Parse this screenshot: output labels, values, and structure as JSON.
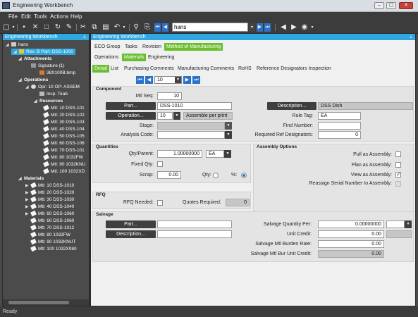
{
  "window": {
    "title": "Engineering Workbench",
    "minimize": "–",
    "maximize": "▢",
    "close": "✕"
  },
  "menu": [
    "File",
    "Edit",
    "Tools",
    "Actions",
    "Help"
  ],
  "toolbar": {
    "search_value": "hans"
  },
  "left_pane": {
    "title": "Engineering Workbench",
    "tree": [
      {
        "label": "hans",
        "level": 0
      },
      {
        "label": "Rev: B Part: DSS-1000",
        "level": 1,
        "selected": true
      },
      {
        "label": "Attachments",
        "level": 2,
        "bold": true
      },
      {
        "label": "Signature (1)",
        "level": 3
      },
      {
        "label": "38X100B.bmp",
        "level": 4
      },
      {
        "label": "Operations",
        "level": 2,
        "bold": true
      },
      {
        "label": "Opr: 10 OP: ASSEM",
        "level": 3
      },
      {
        "label": "Insp: Teab",
        "level": 4
      },
      {
        "label": "Resources",
        "level": 4,
        "bold": true
      },
      {
        "label": "Mtl: 10 DSS-101",
        "level": 5
      },
      {
        "label": "Mtl: 20 DSS-102",
        "level": 5
      },
      {
        "label": "Mtl: 30 DSS-103",
        "level": 5
      },
      {
        "label": "Mtl: 40 DSS-104",
        "level": 5
      },
      {
        "label": "Mtl: 50 DSS-105",
        "level": 5
      },
      {
        "label": "Mtl: 60 DSS-106",
        "level": 5
      },
      {
        "label": "Mtl: 70 DSS-101",
        "level": 5
      },
      {
        "label": "Mtl: 80 1032FW",
        "level": 5
      },
      {
        "label": "Mtl: 90 1032KNU",
        "level": 5
      },
      {
        "label": "Mtl: 100 1032XD",
        "level": 5
      },
      {
        "label": "Materials",
        "level": 2,
        "bold": true
      },
      {
        "label": "Mtl: 10 DSS-1010",
        "level": 3
      },
      {
        "label": "Mtl: 20 DSS-1020",
        "level": 3
      },
      {
        "label": "Mtl: 30 DSS-1030",
        "level": 3
      },
      {
        "label": "Mtl: 40 DSS-1040",
        "level": 3
      },
      {
        "label": "Mtl: 60 DSS-1060",
        "level": 3
      },
      {
        "label": "Mtl: 60 DSS-1060",
        "level": 3
      },
      {
        "label": "Mtl: 70 DSS-1012",
        "level": 3
      },
      {
        "label": "Mtl: 80 1032FW",
        "level": 3
      },
      {
        "label": "Mtl: 90 1032KNUT",
        "level": 3
      },
      {
        "label": "Mtl: 100 1032X080",
        "level": 3
      }
    ]
  },
  "right_pane": {
    "title": "Engineering Workbench",
    "top_tabs": [
      "ECO Group",
      "Tasks",
      "Revision",
      "Method of Manufacturing"
    ],
    "sub_tabs": [
      "Operations",
      "Materials",
      "Engineering"
    ],
    "detail_tabs": [
      "Detail",
      "List",
      "Purchasing Comments",
      "Manufacturing Comments",
      "RoHS",
      "Reference Designators",
      "Inspection"
    ],
    "nav_value": "10"
  },
  "component": {
    "heading": "Component",
    "mtl_seq_label": "Mtl Seq:",
    "mtl_seq": "10",
    "part_btn": "Part...",
    "part": "DSS-1010",
    "description_btn": "Description...",
    "description": "DSS Dish",
    "operation_btn": "Operation...",
    "operation": "10",
    "operation_desc": "Assemble per print",
    "rule_tag_label": "Rule Tag:",
    "rule_tag": "EA",
    "stage_label": "Stage:",
    "find_number_label": "Find Number:",
    "analysis_code_label": "Analysis Code:",
    "required_ref_label": "Required Ref Designators:",
    "required_ref": "0"
  },
  "quantities": {
    "heading": "Quantities",
    "qty_parent_label": "Qty/Parent:",
    "qty_parent": "1.00000000",
    "uom": "EA",
    "fixed_qty_label": "Fixed Qty:",
    "scrap_label": "Scrap:",
    "scrap": "0.00",
    "qty_radio_label": "Qty:",
    "pct_radio_label": "%:"
  },
  "assembly": {
    "heading": "Assembly Options",
    "pull_label": "Pull as Assembly:",
    "plan_label": "Plan as Assembly:",
    "view_label": "View as Assembly:",
    "reassign_label": "Reassign Serial Number to Assembly:"
  },
  "rfq": {
    "heading": "RFQ",
    "needed_label": "RFQ Needed:",
    "quotes_label": "Quotes Required:",
    "quotes": "0"
  },
  "salvage": {
    "heading": "Salvage",
    "part_btn": "Part...",
    "description_btn": "Description...",
    "qty_per_label": "Salvage Quantity Per:",
    "qty_per": "0.00000000",
    "unit_credit_label": "Unit Credit:",
    "unit_credit": "0.00",
    "burden_label": "Salvage Mtl Burden Rate:",
    "burden": "0.00",
    "bur_unit_label": "Salvage Mtl Bur Unit Credit:",
    "bur_unit": "0.00"
  },
  "status": "Ready",
  "colors": {
    "accent_blue": "#2ea7e0",
    "tab_green": "#6abe2f",
    "nav_blue": "#2a72c8"
  }
}
